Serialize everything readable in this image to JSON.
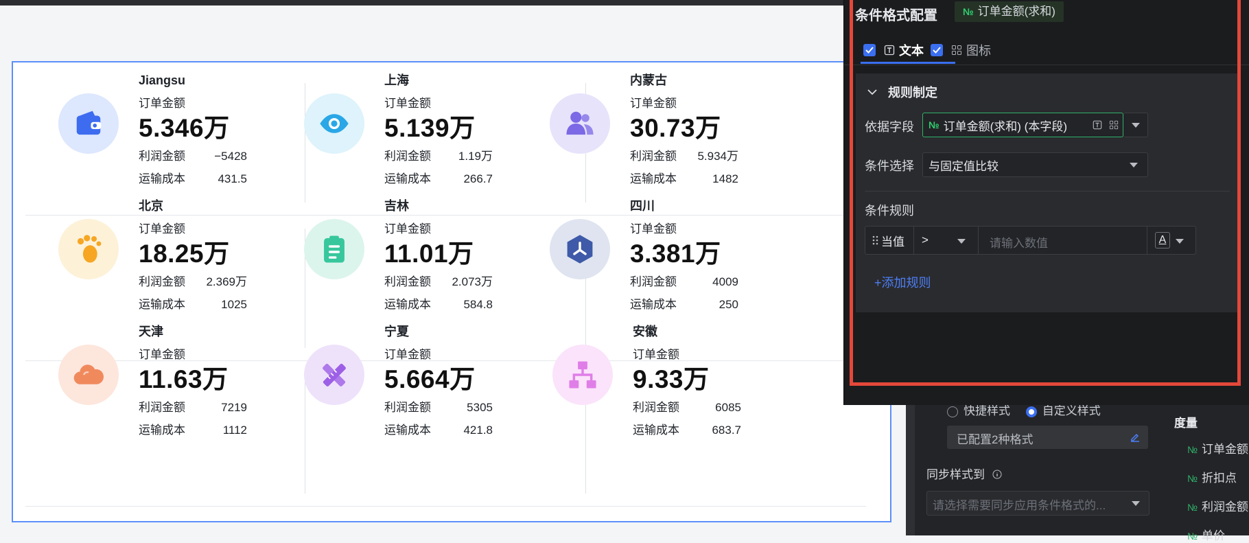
{
  "cards": [
    {
      "name": "Jiangsu",
      "metric_label": "订单金额",
      "value": "5.346万",
      "sub1_label": "利润金额",
      "sub1_value": "−5428",
      "sub2_label": "运输成本",
      "sub2_value": "431.5",
      "icon": "wallet-icon",
      "icon_color": "#3d6cf0",
      "icon_bg": "#dde7fd"
    },
    {
      "name": "上海",
      "metric_label": "订单金额",
      "value": "5.139万",
      "sub1_label": "利润金额",
      "sub1_value": "1.19万",
      "sub2_label": "运输成本",
      "sub2_value": "266.7",
      "icon": "eye-icon",
      "icon_color": "#2aa7e6",
      "icon_bg": "#def3fb"
    },
    {
      "name": "内蒙古",
      "metric_label": "订单金额",
      "value": "30.73万",
      "sub1_label": "利润金额",
      "sub1_value": "5.934万",
      "sub2_label": "运输成本",
      "sub2_value": "1482",
      "icon": "users-icon",
      "icon_color": "#7b69e6",
      "icon_bg": "#e7e3fb"
    },
    {
      "name": "北京",
      "metric_label": "订单金额",
      "value": "18.25万",
      "sub1_label": "利润金额",
      "sub1_value": "2.369万",
      "sub2_label": "运输成本",
      "sub2_value": "1025",
      "icon": "footprint-icon",
      "icon_color": "#f6a623",
      "icon_bg": "#fdf1d8"
    },
    {
      "name": "吉林",
      "metric_label": "订单金额",
      "value": "11.01万",
      "sub1_label": "利润金额",
      "sub1_value": "2.073万",
      "sub2_label": "运输成本",
      "sub2_value": "584.8",
      "icon": "clipboard-icon",
      "icon_color": "#38c79d",
      "icon_bg": "#dcf5ec"
    },
    {
      "name": "四川",
      "metric_label": "订单金额",
      "value": "3.381万",
      "sub1_label": "利润金额",
      "sub1_value": "4009",
      "sub2_label": "运输成本",
      "sub2_value": "250",
      "icon": "cube-icon",
      "icon_color": "#3e5aa8",
      "icon_bg": "#dfe4f0"
    },
    {
      "name": "天津",
      "metric_label": "订单金额",
      "value": "11.63万",
      "sub1_label": "利润金额",
      "sub1_value": "7219",
      "sub2_label": "运输成本",
      "sub2_value": "1112",
      "icon": "cloud-icon",
      "icon_color": "#f08a5d",
      "icon_bg": "#fde6dc"
    },
    {
      "name": "宁夏",
      "metric_label": "订单金额",
      "value": "5.664万",
      "sub1_label": "利润金额",
      "sub1_value": "5305",
      "sub2_label": "运输成本",
      "sub2_value": "421.8",
      "icon": "ruler-pencil-icon",
      "icon_color": "#9d5fe6",
      "icon_bg": "#eee2fb"
    },
    {
      "name": "安徽",
      "metric_label": "订单金额",
      "value": "9.33万",
      "sub1_label": "利润金额",
      "sub1_value": "6085",
      "sub2_label": "运输成本",
      "sub2_value": "683.7",
      "icon": "hierarchy-icon",
      "icon_color": "#e07ee8",
      "icon_bg": "#fbe3fb"
    }
  ],
  "popup": {
    "title": "条件格式配置",
    "field_tag": "订单金额(求和)",
    "tabs": [
      {
        "label": "文本",
        "checked": true
      },
      {
        "label": "图标",
        "checked": true
      }
    ],
    "section_title": "规则制定",
    "basis_label": "依据字段",
    "basis_value": "订单金额(求和) (本字段)",
    "condition_label": "条件选择",
    "condition_value": "与固定值比较",
    "rules_label": "条件规则",
    "rule_subject": "当值",
    "rule_operator": ">",
    "rule_value_placeholder": "请输入数值",
    "rule_text_style": "A",
    "add_rule": "+添加规则"
  },
  "settings": {
    "quick_style": "快捷样式",
    "custom_style": "自定义样式",
    "configured": "已配置2种格式",
    "sync_label": "同步样式到",
    "sync_placeholder": "请选择需要同步应用条件格式的...",
    "measures_title": "度量",
    "measures": [
      "订单金额",
      "折扣点",
      "利润金额",
      "单价"
    ]
  },
  "colors": {
    "accent": "#3a6ff0",
    "highlight_border": "#e4483a",
    "card_border": "#5b8ff9",
    "field_green": "#2fcf70"
  }
}
